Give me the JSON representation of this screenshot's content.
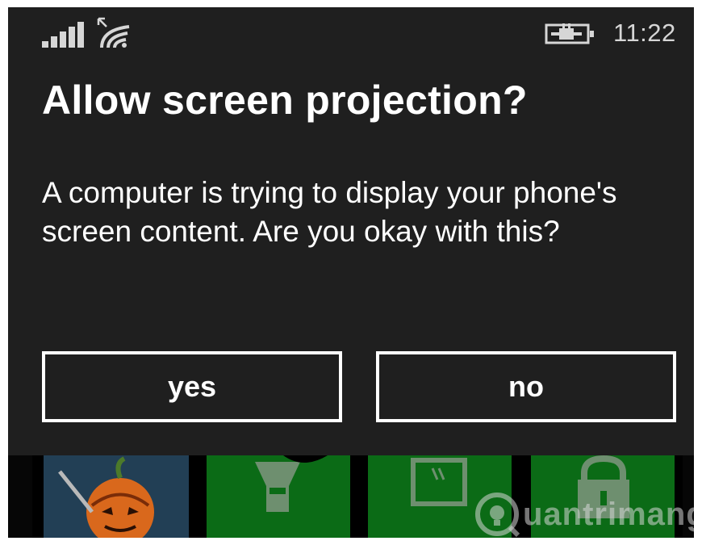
{
  "status_bar": {
    "time": "11:22",
    "icons": [
      "signal-strength-icon",
      "wifi-projection-icon",
      "battery-charging-icon"
    ]
  },
  "dialog": {
    "title": "Allow screen projection?",
    "message": "A computer is trying to display your phone's screen content. Are you okay with this?",
    "yes_label": "yes",
    "no_label": "no"
  },
  "background_tiles": {
    "icons": [
      "game-tile-icon",
      "flashlight-icon",
      "projector-icon",
      "lock-icon"
    ],
    "tile_color": "#0b6b16"
  },
  "watermark": {
    "text": "uantrimang"
  },
  "colors": {
    "dialog_background": "#1f1f1f",
    "text": "#ffffff",
    "accent_tile": "#0b6b16"
  }
}
